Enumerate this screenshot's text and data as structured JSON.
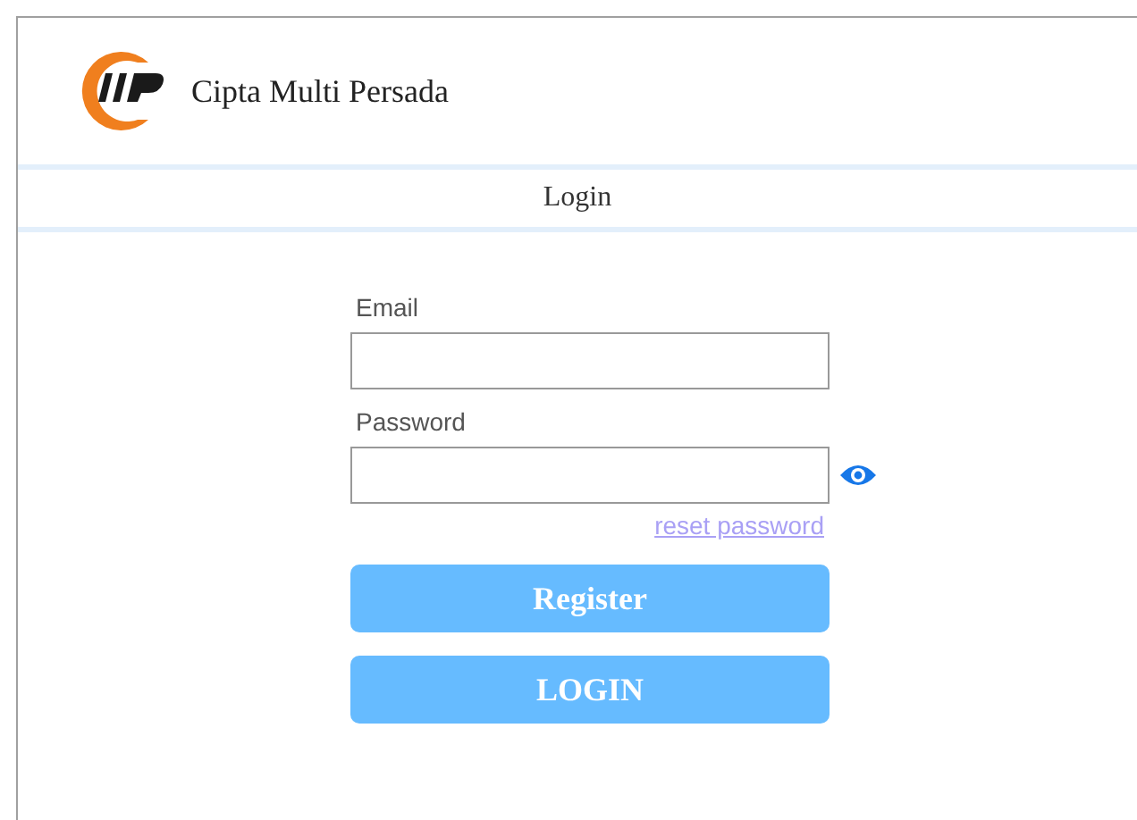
{
  "header": {
    "company": "Cipta Multi Persada"
  },
  "nav": {
    "title": "Login"
  },
  "form": {
    "email": {
      "label": "Email"
    },
    "password": {
      "label": "Password"
    },
    "reset_link": "reset password",
    "buttons": [
      {
        "label": "Register"
      },
      {
        "label": "LOGIN"
      }
    ]
  }
}
